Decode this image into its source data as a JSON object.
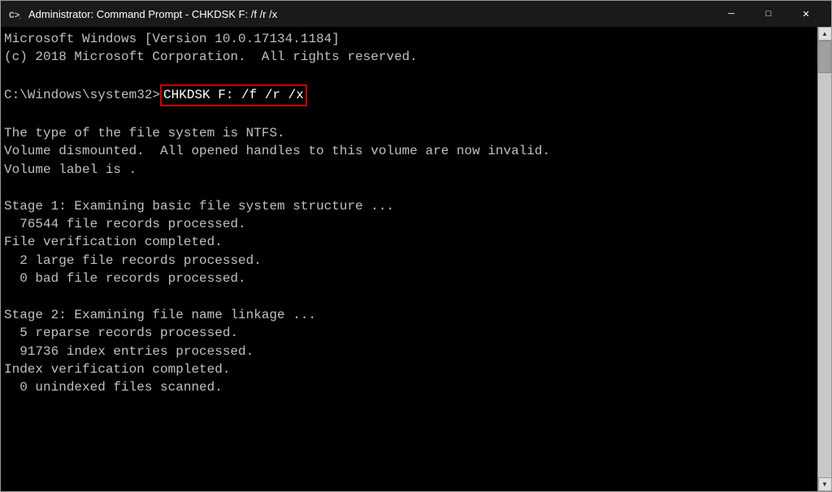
{
  "window": {
    "title": "Administrator: Command Prompt - CHKDSK F: /f /r /x"
  },
  "titlebar": {
    "minimize_label": "─",
    "maximize_label": "□",
    "close_label": "✕"
  },
  "terminal": {
    "line1": "Microsoft Windows [Version 10.0.17134.1184]",
    "line2": "(c) 2018 Microsoft Corporation.  All rights reserved.",
    "line3": "",
    "prompt": "C:\\Windows\\system32>",
    "command": "CHKDSK F: /f /r /x",
    "line5": "",
    "line6": "The type of the file system is NTFS.",
    "line7": "Volume dismounted.  All opened handles to this volume are now invalid.",
    "line8": "Volume label is .",
    "line9": "",
    "line10": "Stage 1: Examining basic file system structure ...",
    "line11": "  76544 file records processed.",
    "line12": "File verification completed.",
    "line13": "  2 large file records processed.",
    "line14": "  0 bad file records processed.",
    "line15": "",
    "line16": "Stage 2: Examining file name linkage ...",
    "line17": "  5 reparse records processed.",
    "line18": "  91736 index entries processed.",
    "line19": "Index verification completed.",
    "line20": "  0 unindexed files scanned."
  }
}
